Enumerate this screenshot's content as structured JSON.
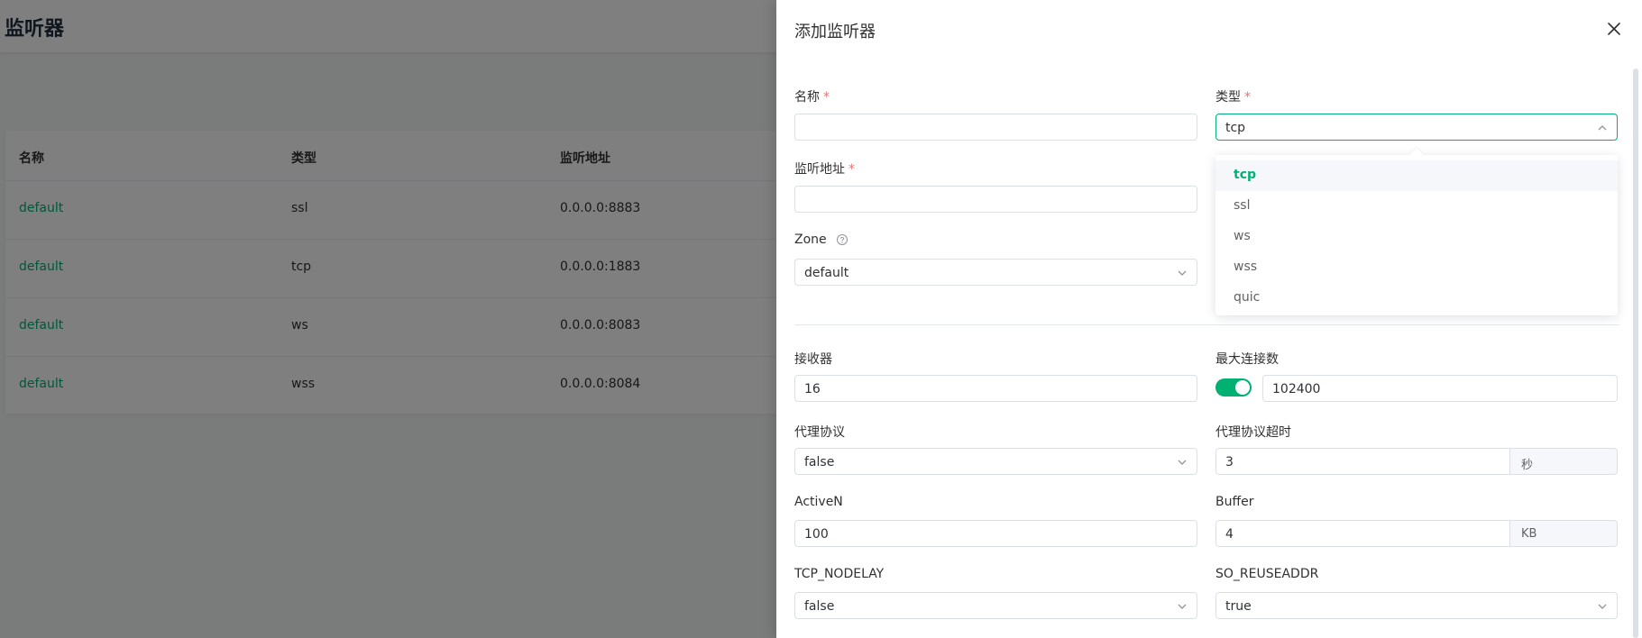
{
  "page": {
    "title": "监听器",
    "table": {
      "columns": [
        "名称",
        "类型",
        "监听地址"
      ],
      "rows": [
        {
          "name": "default",
          "type": "ssl",
          "address": "0.0.0.0:8883"
        },
        {
          "name": "default",
          "type": "tcp",
          "address": "0.0.0.0:1883"
        },
        {
          "name": "default",
          "type": "ws",
          "address": "0.0.0.0:8083"
        },
        {
          "name": "default",
          "type": "wss",
          "address": "0.0.0.0:8084"
        }
      ]
    }
  },
  "drawer": {
    "title": "添加监听器",
    "required_mark": "*",
    "fields": {
      "name": {
        "label": "名称",
        "value": ""
      },
      "type": {
        "label": "类型",
        "value": "tcp"
      },
      "bind": {
        "label": "监听地址",
        "value": ""
      },
      "zone": {
        "label": "Zone",
        "value": "default"
      },
      "acceptors": {
        "label": "接收器",
        "value": "16"
      },
      "max_connections": {
        "label": "最大连接数",
        "value": "102400",
        "enabled": true
      },
      "proxy_protocol": {
        "label": "代理协议",
        "value": "false"
      },
      "proxy_protocol_timeout": {
        "label": "代理协议超时",
        "value": "3",
        "unit": "秒"
      },
      "active_n": {
        "label": "ActiveN",
        "value": "100"
      },
      "buffer": {
        "label": "Buffer",
        "value": "4",
        "unit": "KB"
      },
      "tcp_nodelay": {
        "label": "TCP_NODELAY",
        "value": "false"
      },
      "so_reuseaddr": {
        "label": "SO_REUSEADDR",
        "value": "true"
      }
    },
    "type_options": [
      "tcp",
      "ssl",
      "ws",
      "wss",
      "quic"
    ],
    "type_selected": "tcp"
  },
  "colors": {
    "accent": "#00b173",
    "required": "#f56c6c"
  }
}
